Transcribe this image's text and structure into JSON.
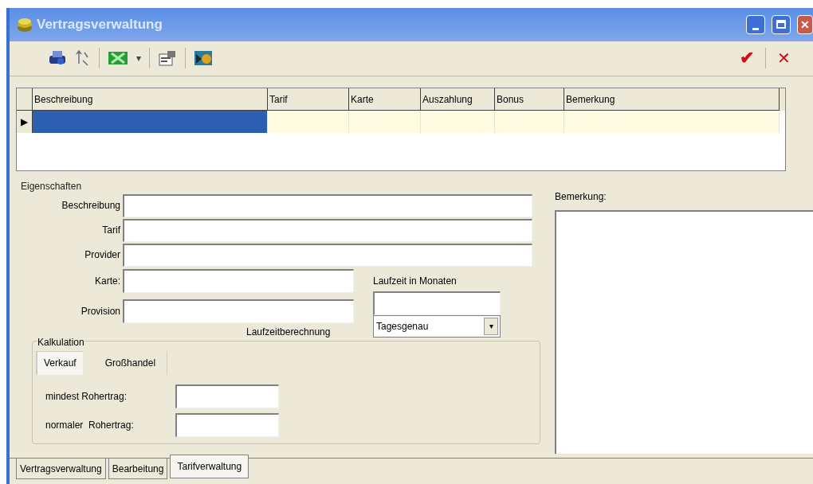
{
  "window": {
    "title": "Vertragsverwaltung"
  },
  "toolbar": {
    "dropdown_arrow": "▾",
    "ok": "✔",
    "cancel": "✕"
  },
  "grid": {
    "columns": [
      "Beschreibung",
      "Tarif",
      "Karte",
      "Auszahlung",
      "Bonus",
      "Bemerkung"
    ],
    "row_marker": "▶",
    "rows": [
      {
        "selected": true
      }
    ]
  },
  "eigenschaften": {
    "title": "Eigenschaften",
    "fields": [
      {
        "label": "Beschreibung"
      },
      {
        "label": "Tarif"
      },
      {
        "label": "Provider"
      }
    ],
    "short_fields": [
      {
        "label": "Karte:"
      },
      {
        "label": "Provision"
      }
    ],
    "laufzeit": {
      "label": "Laufzeit in Monaten"
    },
    "laufzeitberechnung": {
      "label": "Laufzeitberechnung",
      "value": "Tagesgenau"
    }
  },
  "kalkulation": {
    "title": "Kalkulation",
    "tabs": [
      {
        "label": "Verkauf",
        "selected": true
      },
      {
        "label": "Großhandel",
        "selected": false
      }
    ],
    "fields": [
      {
        "label": "mindest Rohertrag:"
      },
      {
        "label": "normaler  Rohertrag:"
      }
    ]
  },
  "bemerkung": {
    "label": "Bemerkung:"
  },
  "bottom_tabs": [
    {
      "label": "Vertragsverwaltung",
      "selected": false
    },
    {
      "label": "Bearbeitung",
      "selected": false
    },
    {
      "label": "Tarifverwaltung",
      "selected": true
    }
  ]
}
